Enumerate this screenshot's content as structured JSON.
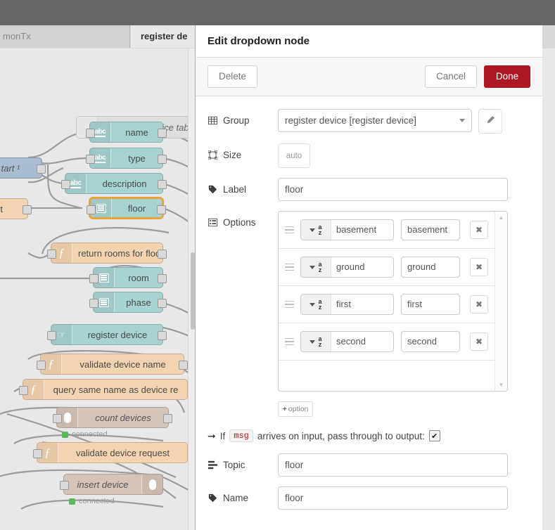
{
  "tabs": [
    {
      "label": "monTx",
      "active": false
    },
    {
      "label": "register de",
      "active": true
    }
  ],
  "canvas": {
    "group_label": "register device tab",
    "nodes": [
      {
        "label": "tart ¹",
        "icon": "",
        "color": "blue"
      },
      {
        "label": "rt",
        "icon": "",
        "color": "orange"
      },
      {
        "label": "name",
        "icon": "abc-icon",
        "color": "tealish"
      },
      {
        "label": "type",
        "icon": "abc-icon",
        "color": "tealish"
      },
      {
        "label": "description",
        "icon": "abc-icon",
        "color": "tealish"
      },
      {
        "label": "floor",
        "icon": "list-icon",
        "color": "tealish",
        "selected": true
      },
      {
        "label": "return rooms for floor",
        "icon": "function-icon",
        "color": "orange"
      },
      {
        "label": "room",
        "icon": "list-icon",
        "color": "tealish"
      },
      {
        "label": "phase",
        "icon": "list-icon",
        "color": "tealish"
      },
      {
        "label": "register device",
        "icon": "hand-pointer-icon",
        "color": "tealish"
      },
      {
        "label": "validate device name",
        "icon": "function-icon",
        "color": "orange"
      },
      {
        "label": "query same name as device re",
        "icon": "function-icon",
        "color": "orange"
      },
      {
        "label": "count devices",
        "icon": "database-icon",
        "color": "brown",
        "italic": true,
        "status": "connected"
      },
      {
        "label": "validate device request",
        "icon": "function-icon",
        "color": "orange"
      },
      {
        "label": "insert device",
        "icon": "database-icon",
        "color": "brown",
        "italic": true,
        "status": "connected"
      }
    ]
  },
  "dialog": {
    "title": "Edit dropdown node",
    "toolbar": {
      "delete_label": "Delete",
      "cancel_label": "Cancel",
      "done_label": "Done"
    },
    "fields": {
      "group": {
        "label": "Group",
        "icon": "table-icon",
        "value": "register device [register device]",
        "edit_icon": "pencil-icon"
      },
      "size": {
        "label": "Size",
        "icon": "object-group-icon",
        "value": "auto"
      },
      "label": {
        "label": "Label",
        "icon": "tag-icon",
        "value": "floor"
      },
      "options": {
        "label": "Options",
        "icon": "list-alt-icon"
      },
      "topic": {
        "label": "Topic",
        "icon": "tasks-icon",
        "value": "floor"
      },
      "name": {
        "label": "Name",
        "icon": "tag-icon",
        "value": "floor"
      }
    },
    "options": [
      {
        "type": "az",
        "label": "basement",
        "value": "basement",
        "delete_icon": "close-icon"
      },
      {
        "type": "az",
        "label": "ground",
        "value": "ground",
        "delete_icon": "close-icon"
      },
      {
        "type": "az",
        "label": "first",
        "value": "first",
        "delete_icon": "close-icon"
      },
      {
        "type": "az",
        "label": "second",
        "value": "second",
        "delete_icon": "close-icon"
      }
    ],
    "add_option_label": "option",
    "passthrough": {
      "prefix": "If",
      "chip": "msg",
      "suffix": "arrives on input, pass through to output:",
      "checked": true
    }
  },
  "colors": {
    "accent_red": "#ad1625",
    "topbar": "#666666",
    "canvas_bg": "#e8e8e8",
    "node_teal": "#a7d3d2",
    "node_orange": "#f3d3b0",
    "node_brown": "#d5c4b8",
    "node_blue": "#a9bcd0",
    "selected_outline": "#e8a33d",
    "status_green": "#5cb85c"
  }
}
